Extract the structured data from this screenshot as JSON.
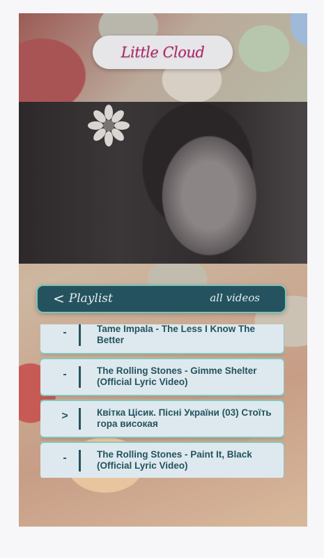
{
  "app": {
    "logo_text": "Little Cloud"
  },
  "playlist": {
    "back_chevron": "<",
    "back_label": "Playlist",
    "all_videos_label": "all videos",
    "items": [
      {
        "marker": "-",
        "title": "Tame Impala - The Less I Know The Better",
        "playing": false
      },
      {
        "marker": "-",
        "title": "The Rolling Stones - Gimme Shelter (Official Lyric Video)",
        "playing": false
      },
      {
        "marker": ">",
        "title": "Квітка Цісик. Пісні України (03) Стоїть гора високая",
        "playing": true
      },
      {
        "marker": "-",
        "title": "The Rolling Stones - Paint It, Black (Official Lyric Video)",
        "playing": false
      }
    ]
  },
  "colors": {
    "accent": "#24535f",
    "logo": "#b4246e",
    "item_bg": "#dde9ee",
    "item_border": "#88c6bb"
  }
}
